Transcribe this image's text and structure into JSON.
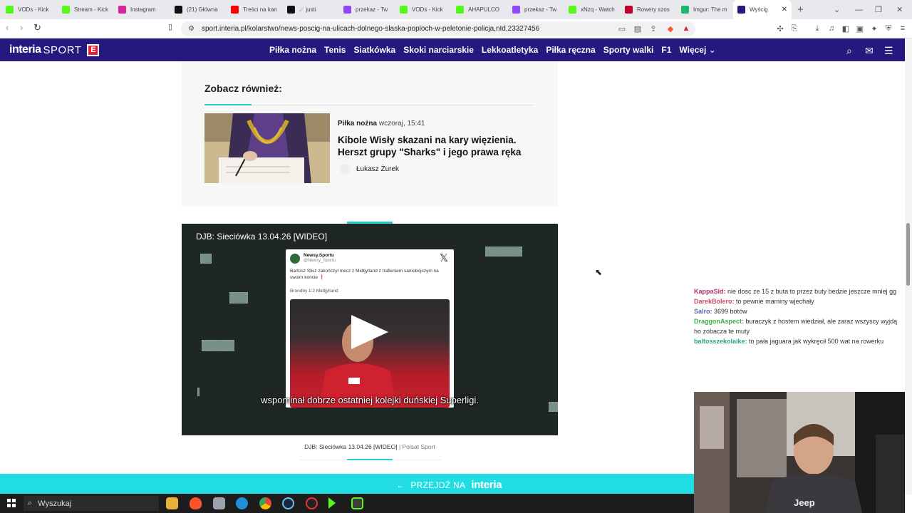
{
  "browser": {
    "tabs": [
      {
        "title": "VODs - Kick",
        "favicon": "kick-icon",
        "color": "#53fc18"
      },
      {
        "title": "Stream - Kick",
        "favicon": "kick-icon",
        "color": "#53fc18"
      },
      {
        "title": "Instagram",
        "favicon": "instagram-icon",
        "color": "#d6249f"
      },
      {
        "title": "(21) Główna",
        "favicon": "x-icon",
        "color": "#111111"
      },
      {
        "title": "Treści na kan",
        "favicon": "youtube-icon",
        "color": "#ff0000"
      },
      {
        "title": "☄ justi",
        "favicon": "tiktok-icon",
        "color": "#111111"
      },
      {
        "title": "przekaz - Tw",
        "favicon": "twitch-icon",
        "color": "#9146ff"
      },
      {
        "title": "VODs - Kick",
        "favicon": "kick-icon",
        "color": "#53fc18"
      },
      {
        "title": "AHAPULCO",
        "favicon": "kick-icon",
        "color": "#53fc18"
      },
      {
        "title": "przekaz - Tw",
        "favicon": "twitch-icon",
        "color": "#9146ff"
      },
      {
        "title": "xNzq - Watch",
        "favicon": "kick-icon",
        "color": "#53fc18"
      },
      {
        "title": "Rowery szos",
        "favicon": "olx-icon",
        "color": "#c4002b"
      },
      {
        "title": "Imgur: The m",
        "favicon": "imgur-icon",
        "color": "#1bb76e"
      },
      {
        "title": "Wyścig",
        "favicon": "interia-icon",
        "color": "#24197d",
        "active": true
      }
    ],
    "url": "sport.interia.pl/kolarstwo/news-poscig-na-ulicach-dolnego-slaska-poploch-w-peletonie-policja,nId,23327456"
  },
  "site": {
    "logo_main": "interia",
    "logo_section": "SPORT",
    "logo_badge": "E",
    "nav": [
      "Piłka nożna",
      "Tenis",
      "Siatkówka",
      "Skoki narciarskie",
      "Lekkoatletyka",
      "Piłka ręczna",
      "Sporty walki",
      "F1",
      "Więcej"
    ]
  },
  "related": {
    "heading": "Zobacz również:",
    "category": "Piłka nożna",
    "date": "wczoraj, 15:41",
    "title": "Kibole Wisły skazani na kary więzienia. Herszt grupy \"Sharks\" i jego prawa ręka",
    "author": "Łukasz Żurek"
  },
  "video": {
    "title": "DJB: Sieciówka 13.04.26 [WIDEO]",
    "card_name": "Newsy.Sportu",
    "card_handle": "@Newsy_Sportu",
    "card_text": "Bartosz Slisz zakończył mecz z Midtjylland z trafieniem samobójczym na swoim koncie ❗",
    "card_score": "Brondby 1:2 Midtjylland",
    "subtitle": "wspominał dobrze ostatniej kolejki duńskiej Superligi.",
    "caption": "DJB: Sieciówka 13.04.26 [WIDEO]",
    "caption_source": "Polsat Sport"
  },
  "chat": [
    {
      "user": "KappaSid:",
      "text": "nie dosc ze 15 z buta to przez buty bedzie jeszcze mniej gg",
      "color": "#b3306b"
    },
    {
      "user": "DarekBolero:",
      "text": "to pewnie maminy wjechały",
      "color": "#d04a66"
    },
    {
      "user": "Salro:",
      "text": "3699 botów",
      "color": "#5566aa"
    },
    {
      "user": "DraggonAspect:",
      "text": "buraczyk z hostem wiedział, ale zaraz wszyscy wyjdą ho zobacza te muty",
      "color": "#3fae3f"
    },
    {
      "user": "baltosszekolaike:",
      "text": "to pała jaguara jak wykręcił 500 wat na rowerku",
      "color": "#2aa18b"
    }
  ],
  "banner": {
    "prefix": "PRZEJDŹ NA",
    "brand": "interia"
  },
  "taskbar": {
    "search_placeholder": "Wyszukaj"
  },
  "webcam": {
    "shirt_text": "Jeep"
  }
}
